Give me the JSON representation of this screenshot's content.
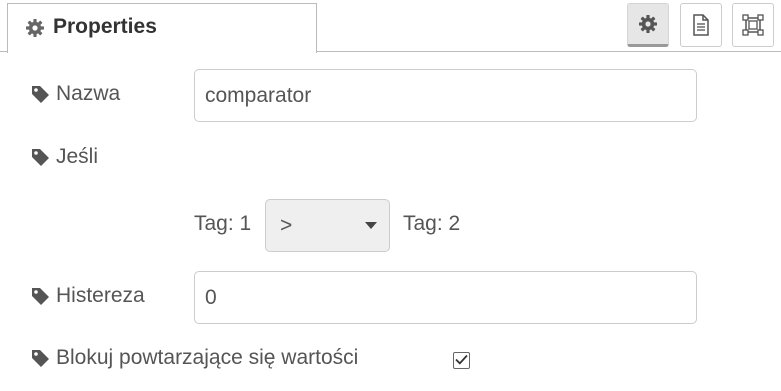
{
  "tab": {
    "title": "Properties",
    "icon": "gear-icon"
  },
  "toolbar": {
    "buttons": [
      {
        "name": "node-properties",
        "icon": "gear-icon",
        "active": true
      },
      {
        "name": "node-description",
        "icon": "document-icon",
        "active": false
      },
      {
        "name": "node-appearance",
        "icon": "frame-icon",
        "active": false
      }
    ]
  },
  "form": {
    "name": {
      "label": "Nazwa",
      "value": "comparator"
    },
    "condition": {
      "label": "Jeśli",
      "left": "Tag: 1",
      "operator": ">",
      "right": "Tag: 2"
    },
    "hysteresis": {
      "label": "Histereza",
      "value": "0"
    },
    "block_repeats": {
      "label": "Blokuj powtarzające się wartości",
      "checked": true
    }
  },
  "colors": {
    "text": "#555555",
    "title": "#333333",
    "border": "#cccccc",
    "select_bg": "#efefef"
  }
}
